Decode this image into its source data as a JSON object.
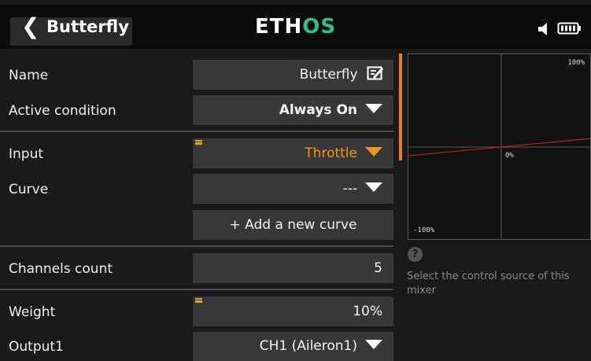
{
  "header": {
    "back_icon": "chevron-left-icon",
    "title": "Butterfly",
    "logo_part1": "ETH",
    "logo_part2": "OS",
    "logo_accent_color": "#25c48a",
    "status_icons": [
      "speaker-icon",
      "battery-icon"
    ]
  },
  "form": {
    "name": {
      "label": "Name",
      "value": "Butterfly",
      "icon": "edit-icon"
    },
    "active_condition": {
      "label": "Active condition",
      "value": "Always On"
    },
    "input": {
      "label": "Input",
      "value": "Throttle",
      "value_color": "#f3951f"
    },
    "curve": {
      "label": "Curve",
      "value": "---"
    },
    "add_curve": {
      "label": "+ Add a new curve"
    },
    "channels_count": {
      "label": "Channels count",
      "value": "5"
    },
    "weight": {
      "label": "Weight",
      "value": "10%"
    },
    "output1": {
      "label": "Output1",
      "value": "CH1 (Aileron1)"
    }
  },
  "graph": {
    "top_label": "100%",
    "center_label": "0%",
    "bottom_label": "-100%",
    "line_color": "#d42020"
  },
  "help": {
    "icon": "question-icon",
    "text": "Select the control source of this mixer"
  }
}
